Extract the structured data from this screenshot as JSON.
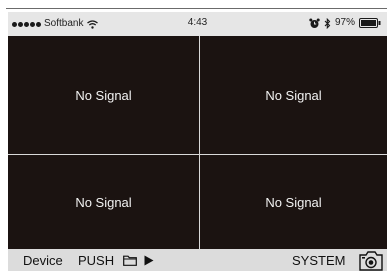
{
  "status_bar": {
    "carrier": "Softbank",
    "time": "4:43",
    "battery": "97%",
    "icons": [
      "signal-dots",
      "wifi-icon",
      "alarm-clock-icon",
      "bluetooth-icon",
      "battery-icon"
    ]
  },
  "channels": [
    {
      "label": "No Signal"
    },
    {
      "label": "No Signal"
    },
    {
      "label": "No Signal"
    },
    {
      "label": "No Signal"
    }
  ],
  "toolbar": {
    "device": "Device",
    "push": "PUSH",
    "system": "SYSTEM",
    "icons": [
      "folder-icon",
      "play-icon",
      "camera-icon"
    ]
  },
  "colors": {
    "video_background": "#1b1311",
    "divider": "#d9d9d9",
    "toolbar_background": "#dcdcdc",
    "status_background": "#e6e6e6"
  }
}
